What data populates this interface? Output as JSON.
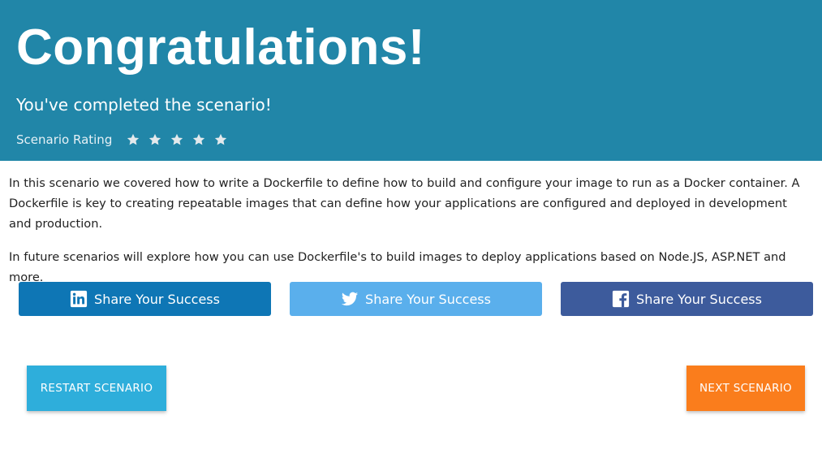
{
  "banner": {
    "title": "Congratulations!",
    "subtitle": "You've completed the scenario!",
    "rating_label": "Scenario Rating",
    "rating_stars": 5,
    "background_color": "#2186a8"
  },
  "content": {
    "paragraph_1": "In this scenario we covered how to write a Dockerfile to define how to build and configure your image to run as a Docker container. A Dockerfile is key to creating repeatable images that can define how your applications are configured and deployed in development and production.",
    "paragraph_2": "In future scenarios will explore how you can use Dockerfile's to build images to deploy applications based on Node.JS, ASP.NET and more."
  },
  "share": {
    "linkedin": {
      "label": "Share Your Success",
      "icon": "linkedin-icon",
      "color": "#0e76b5"
    },
    "twitter": {
      "label": "Share Your Success",
      "icon": "twitter-icon",
      "color": "#5aafec"
    },
    "facebook": {
      "label": "Share Your Success",
      "icon": "facebook-icon",
      "color": "#3d5b9c"
    }
  },
  "actions": {
    "restart_label": "RESTART SCENARIO",
    "restart_color": "#2eaedb",
    "next_label": "NEXT SCENARIO",
    "next_color": "#fa7d1c"
  }
}
